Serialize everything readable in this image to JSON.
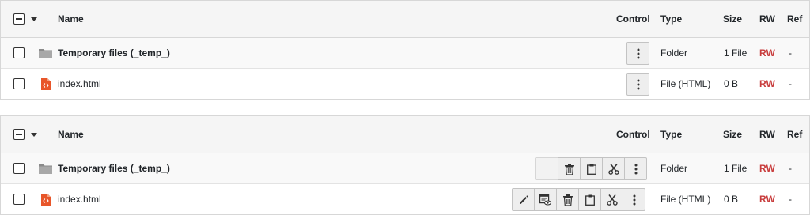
{
  "header": {
    "name": "Name",
    "control": "Control",
    "type": "Type",
    "size": "Size",
    "rw": "RW",
    "ref": "Ref"
  },
  "tables": [
    {
      "rows": [
        {
          "name": "Temporary files (_temp_)",
          "icon": "folder-icon",
          "type": "Folder",
          "size": "1 File",
          "rw": "RW",
          "ref": "-"
        },
        {
          "name": "index.html",
          "icon": "html-file-icon",
          "type": "File (HTML)",
          "size": "0 B",
          "rw": "RW",
          "ref": "-"
        }
      ]
    },
    {
      "rows": [
        {
          "name": "Temporary files (_temp_)",
          "icon": "folder-icon",
          "type": "Folder",
          "size": "1 File",
          "rw": "RW",
          "ref": "-",
          "actions": [
            "delete-icon",
            "paste-icon",
            "cut-icon",
            "more-icon"
          ]
        },
        {
          "name": "index.html",
          "icon": "html-file-icon",
          "type": "File (HTML)",
          "size": "0 B",
          "rw": "RW",
          "ref": "-",
          "actions": [
            "edit-icon",
            "view-icon",
            "delete-icon",
            "paste-icon",
            "cut-icon",
            "more-icon"
          ]
        }
      ]
    }
  ],
  "colors": {
    "rw": "#c83c3c",
    "file_icon": "#e8562a",
    "folder_icon": "#8a8a8a"
  }
}
